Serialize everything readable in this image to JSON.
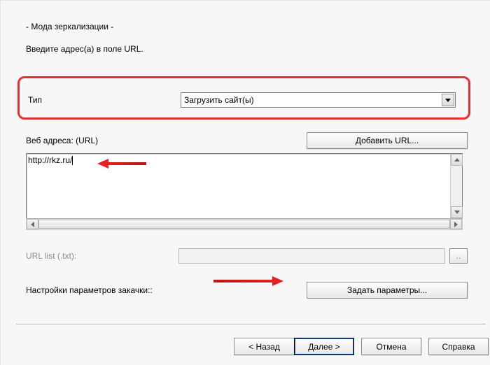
{
  "title": "- Мода зеркализации -",
  "instruction": "Введите адрес(а) в поле URL.",
  "type": {
    "label": "Тип",
    "value": "Загрузить сайт(ы)"
  },
  "addUrl": {
    "label": "Добавить URL..."
  },
  "webAddresses": {
    "label": "Веб адреса: (URL)",
    "value": "http://rkz.ru/"
  },
  "urlList": {
    "label": "URL list (.txt):",
    "browse": ".."
  },
  "params": {
    "label": "Настройки параметров закачки::",
    "button": "Задать параметры..."
  },
  "nav": {
    "back": "< Назад",
    "next": "Далее >",
    "cancel": "Отмена",
    "help": "Справка"
  }
}
